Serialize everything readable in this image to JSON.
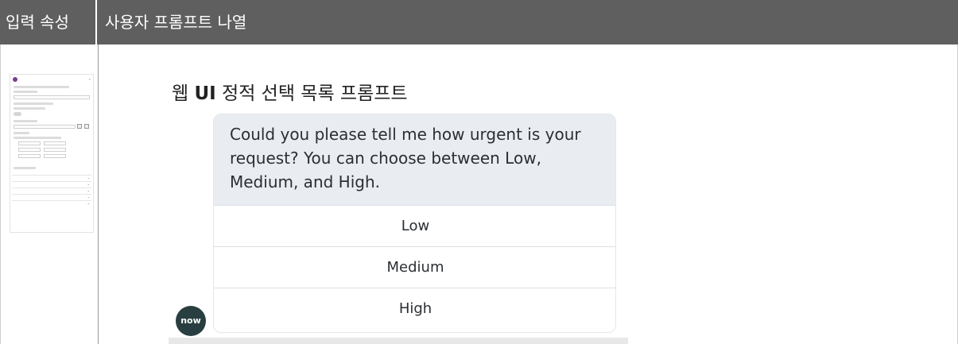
{
  "header": {
    "left_label": "입력 속성",
    "right_label": "사용자 프롬프트 나열"
  },
  "demo": {
    "title_prefix": "웹",
    "title_bold": "UI",
    "title_suffix": "정적 선택 목록 프롬프트",
    "prompt_text": "Could you please tell me how urgent is your request? You can choose between Low, Medium, and High.",
    "choices": [
      "Low",
      "Medium",
      "High"
    ],
    "avatar_text": "now"
  },
  "colors": {
    "header_bg": "#5f5f5f",
    "bubble_bg": "#e9ecf0",
    "avatar_bg": "#293e40"
  }
}
